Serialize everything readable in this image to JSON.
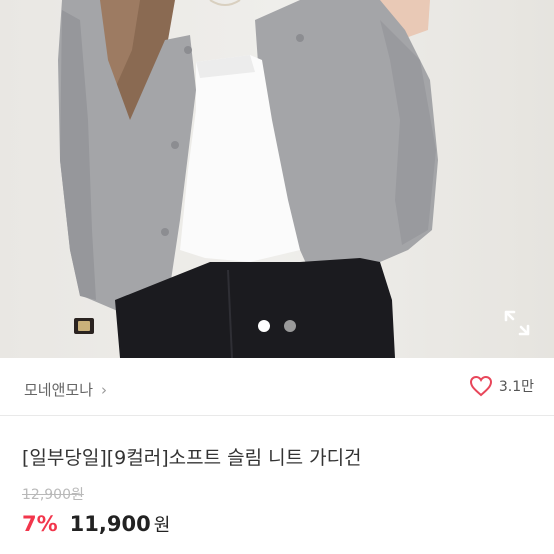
{
  "gallery": {
    "dots": [
      {
        "active": true,
        "color": "#ffffff"
      },
      {
        "active": false,
        "color": "#9a9a9a"
      }
    ],
    "expand_icon": "expand-icon"
  },
  "seller": {
    "name": "모네앤모나",
    "chevron": "›"
  },
  "like": {
    "icon": "heart-icon",
    "count": "3.1만",
    "color": "#e8465a"
  },
  "product": {
    "title": "[일부당일][9컬러]소프트 슬림 니트 가디건",
    "original_price": "12,900원",
    "discount": "7%",
    "price": "11,900",
    "currency": "원"
  },
  "colors": {
    "discount": "#f2364c",
    "cardigan": "#a4a5a8",
    "top": "#fbfbfb",
    "jeans": "#1b1b1f"
  }
}
